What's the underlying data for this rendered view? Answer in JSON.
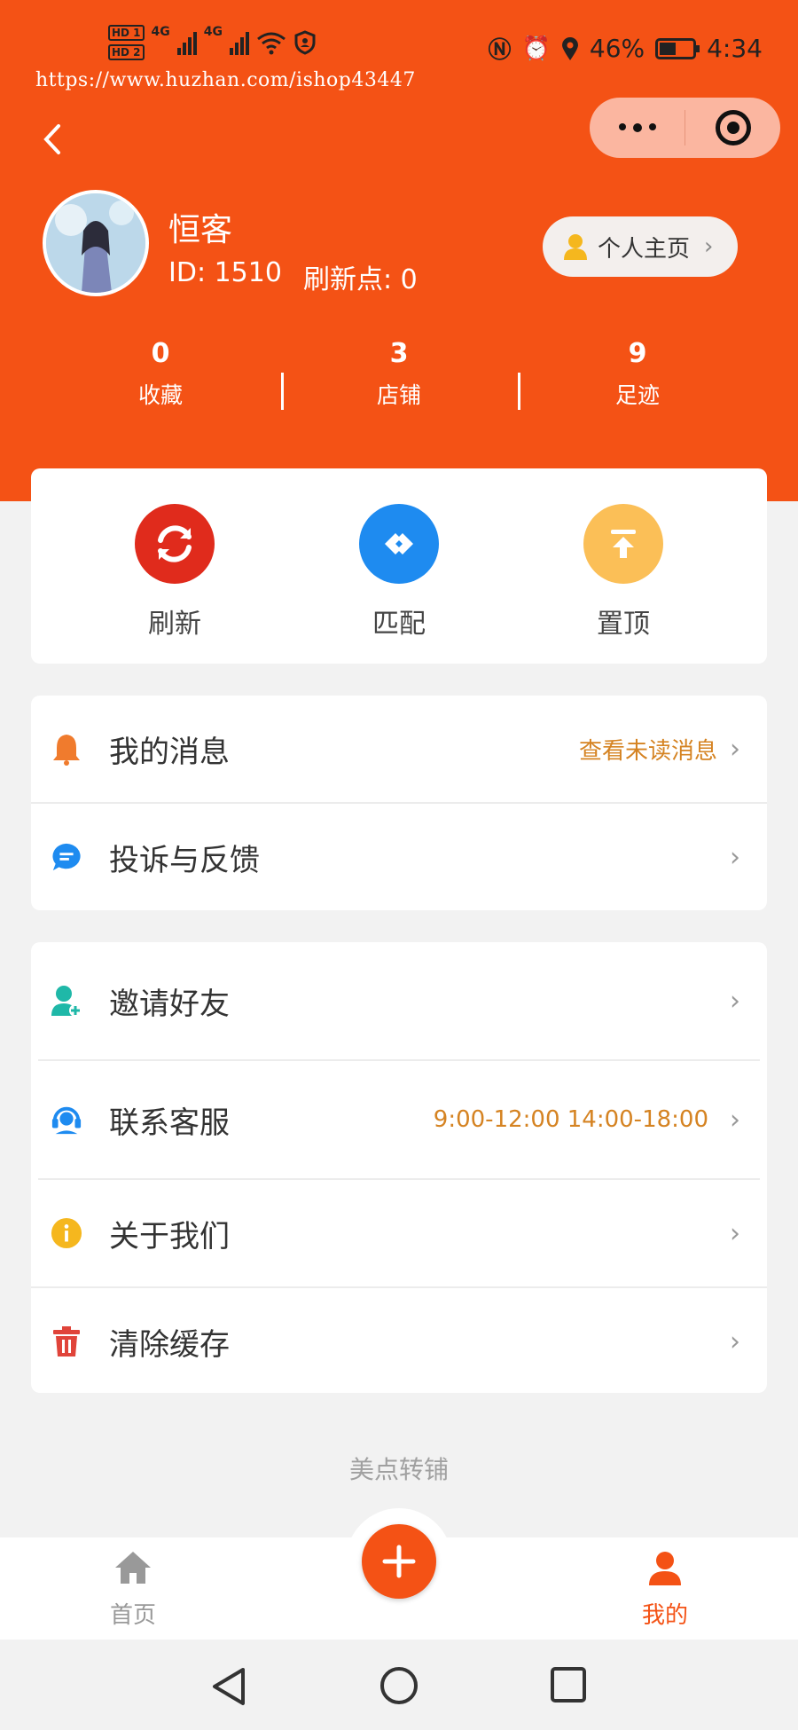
{
  "status_bar": {
    "hd1": "HD 1",
    "hd2": "HD 2",
    "net1": "4G",
    "net2": "4G",
    "battery_pct": "46%",
    "time": "4:34"
  },
  "watermark": "https://www.huzhan.com/ishop43447",
  "profile": {
    "name": "恒客",
    "id_text": "ID: 1510",
    "refresh_points_text": "刷新点: 0",
    "home_button": "个人主页"
  },
  "stats": [
    {
      "value": "0",
      "label": "收藏"
    },
    {
      "value": "3",
      "label": "店铺"
    },
    {
      "value": "9",
      "label": "足迹"
    }
  ],
  "actions": [
    {
      "label": "刷新",
      "icon": "refresh-icon",
      "color": "#e02b1c"
    },
    {
      "label": "匹配",
      "icon": "link-icon",
      "color": "#1e8bf0"
    },
    {
      "label": "置顶",
      "icon": "pin-top-icon",
      "color": "#fbbf57"
    }
  ],
  "menu1": [
    {
      "label": "我的消息",
      "extra": "查看未读消息",
      "icon": "bell-icon"
    },
    {
      "label": "投诉与反馈",
      "extra": "",
      "icon": "chat-bubble-icon"
    }
  ],
  "menu2": [
    {
      "label": "邀请好友",
      "extra": "",
      "icon": "add-user-icon"
    },
    {
      "label": "联系客服",
      "extra": "9:00-12:00 14:00-18:00",
      "icon": "headset-icon"
    },
    {
      "label": "关于我们",
      "extra": "",
      "icon": "info-icon"
    },
    {
      "label": "清除缓存",
      "extra": "",
      "icon": "trash-icon"
    }
  ],
  "footer_text": "美点转铺",
  "tabs": [
    {
      "label": "首页",
      "icon": "home-icon",
      "active": false
    },
    {
      "label": "我的",
      "icon": "user-icon",
      "active": true
    }
  ],
  "colors": {
    "brand": "#f45215",
    "accent_text": "#d58322",
    "inactive_tab": "#999999"
  }
}
